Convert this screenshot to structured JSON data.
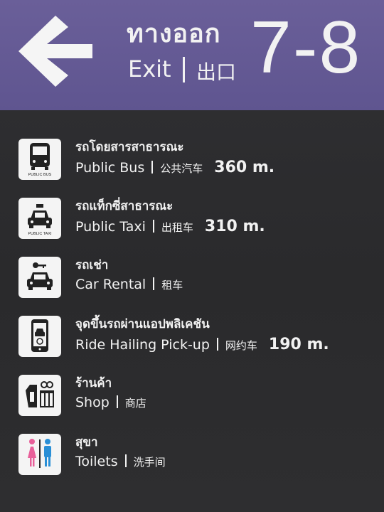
{
  "header": {
    "exit_thai": "ทางออก",
    "exit_en": "Exit",
    "exit_zh": "出口",
    "exit_number": "7-8",
    "background_color": "#6a5f99",
    "arrow_icon": "left-arrow"
  },
  "items": [
    {
      "icon": "bus-icon",
      "caption": "PUBLIC BUS",
      "thai": "รถโดยสารสาธารณะ",
      "en": "Public Bus",
      "zh": "公共汽车",
      "distance": "360 m."
    },
    {
      "icon": "taxi-icon",
      "caption": "PUBLIC TAXI",
      "thai": "รถแท็กซี่สาธารณะ",
      "en": "Public Taxi",
      "zh": "出租车",
      "distance": "310 m."
    },
    {
      "icon": "car-rental-icon",
      "caption": "",
      "thai": "รถเช่า",
      "en": "Car Rental",
      "zh": "租车",
      "distance": ""
    },
    {
      "icon": "ride-hailing-phone-icon",
      "caption": "",
      "thai": "จุดขึ้นรถผ่านแอปพลิเคชัน",
      "en": "Ride Hailing Pick-up",
      "zh": "网约车",
      "distance": "190 m."
    },
    {
      "icon": "shop-icon",
      "caption": "",
      "thai": "ร้านค้า",
      "en": "Shop",
      "zh": "商店",
      "distance": ""
    },
    {
      "icon": "toilet-icon",
      "caption": "",
      "thai": "สุขา",
      "en": "Toilets",
      "zh": "洗手间",
      "distance": ""
    }
  ],
  "colors": {
    "female": "#e8609a",
    "male": "#2a8fd6"
  }
}
